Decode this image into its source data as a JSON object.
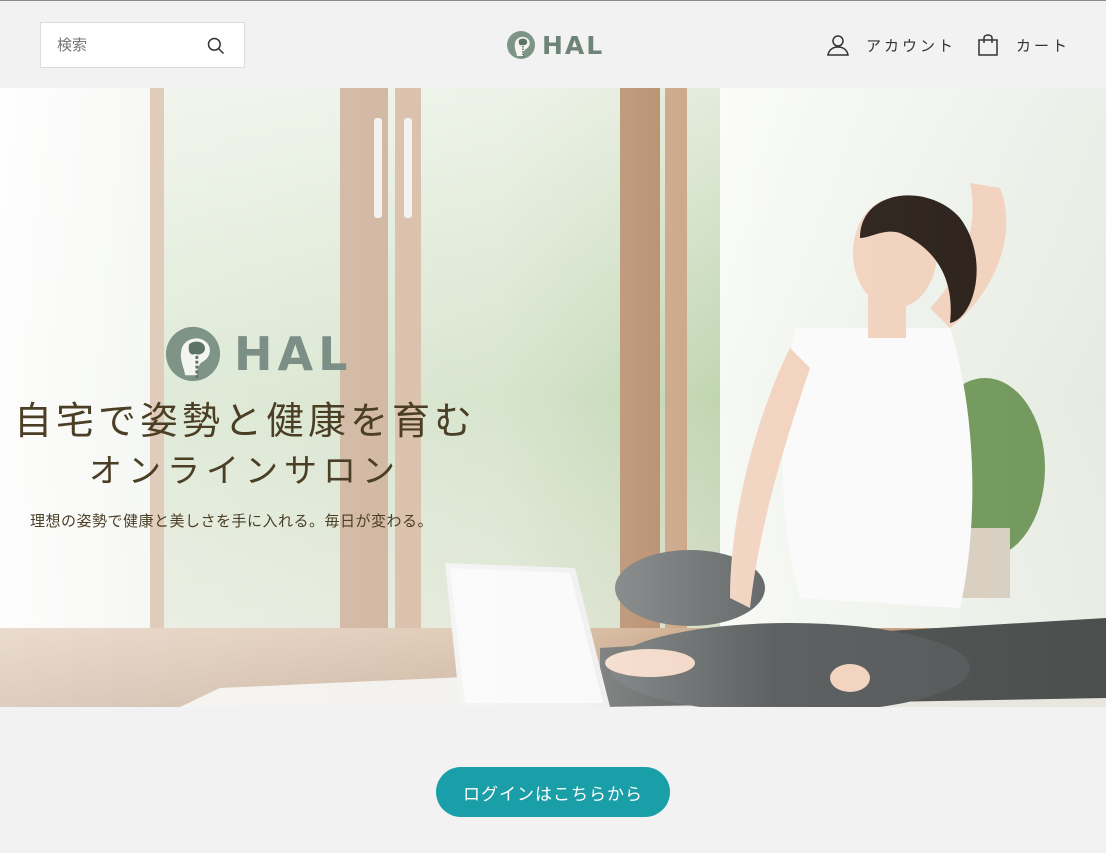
{
  "header": {
    "search": {
      "placeholder": "検索",
      "icon": "search-icon"
    },
    "logo": {
      "text": "HAL",
      "icon": "brain-spine-logo-icon",
      "color": "#6f8478"
    },
    "account": {
      "label": "アカウント",
      "icon": "user-icon"
    },
    "cart": {
      "label": "カート",
      "icon": "shopping-bag-icon"
    }
  },
  "hero": {
    "logo_text": "HAL",
    "title_line1": "自宅で姿勢と健康を育む",
    "title_line2": "オンラインサロン",
    "subtitle": "理想の姿勢で健康と美しさを手に入れる。毎日が変わる。",
    "title_color": "#4a3e24"
  },
  "login": {
    "label": "ログインはこちらから",
    "color": "#1a9ea7"
  }
}
